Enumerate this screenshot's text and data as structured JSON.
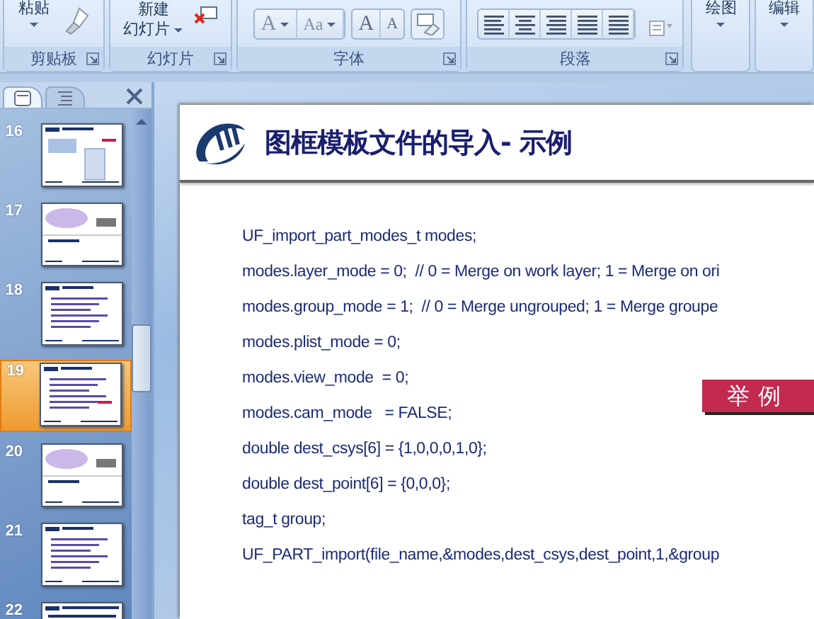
{
  "ribbon": {
    "groups": [
      {
        "kind": "clipboard",
        "label": "剪贴板",
        "button": "粘贴"
      },
      {
        "kind": "slides",
        "label": "幻灯片",
        "button": "新建",
        "sub_button": "幻灯片"
      },
      {
        "kind": "font",
        "label": "字体",
        "font_buttons": [
          "A",
          "Aa"
        ],
        "size_buttons": [
          "A",
          "A"
        ]
      },
      {
        "kind": "paragraph",
        "label": "段落"
      },
      {
        "kind": "drawing",
        "button": "绘图"
      },
      {
        "kind": "editing",
        "button": "编辑"
      }
    ]
  },
  "slides_pane": {
    "tabs": [
      {
        "kind": "slides",
        "selected": true
      },
      {
        "kind": "outline",
        "selected": false
      }
    ],
    "thumbnails": [
      {
        "number": "16",
        "kind": "screens",
        "selected": false
      },
      {
        "number": "17",
        "kind": "car",
        "selected": false
      },
      {
        "number": "18",
        "kind": "text",
        "selected": false
      },
      {
        "number": "19",
        "kind": "text",
        "selected": true
      },
      {
        "number": "20",
        "kind": "car",
        "selected": false
      },
      {
        "number": "21",
        "kind": "text",
        "selected": false
      },
      {
        "number": "22",
        "kind": "dense",
        "selected": false
      }
    ]
  },
  "slide": {
    "title": "图框模板文件的导入- 示例",
    "code_lines": [
      "UF_import_part_modes_t modes;",
      "modes.layer_mode = 0;  // 0 = Merge on work layer; 1 = Merge on ori",
      "modes.group_mode = 1;  // 0 = Merge ungrouped; 1 = Merge groupe",
      "modes.plist_mode = 0;",
      "modes.view_mode  = 0;",
      "modes.cam_mode   = FALSE;",
      "double dest_csys[6] = {1,0,0,0,1,0};",
      "double dest_point[6] = {0,0,0};",
      "tag_t group;",
      "UF_PART_import(file_name,&modes,dest_csys,dest_point,1,&group"
    ],
    "badge": "举例"
  }
}
